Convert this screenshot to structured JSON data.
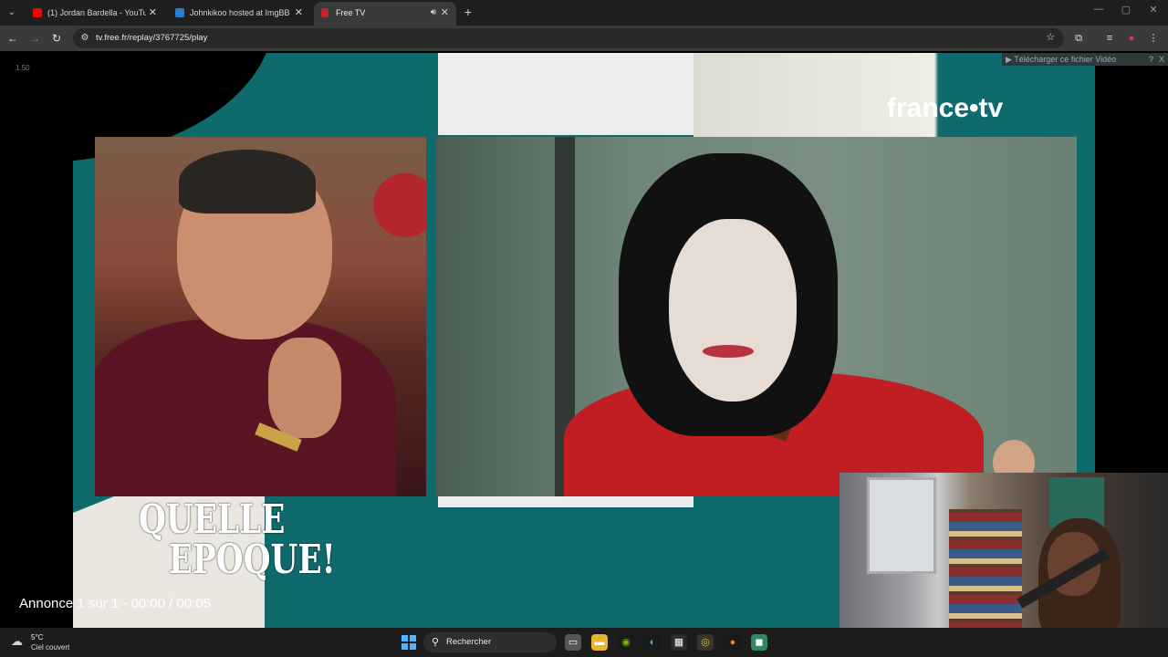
{
  "tabs": [
    {
      "title": "(1) Jordan Bardella - YouTube",
      "icon": "youtube-icon",
      "color": "#ff0000"
    },
    {
      "title": "Johnkikoo hosted at ImgBB —",
      "icon": "imgbb-icon",
      "color": "#2a7fd4"
    },
    {
      "title": "Free TV",
      "icon": "freetv-icon",
      "color": "#c0272d"
    }
  ],
  "new_tab": "+",
  "address": {
    "url": "tv.free.fr/replay/3767725/play"
  },
  "video": {
    "speed": "1.50",
    "channel_logo": "france•tv",
    "show_logo_line1": "QUELLE",
    "show_logo_line2": "EPOQUE!",
    "ad_counter": "Annonce 1 sur 1 - 00:00 / 00:05",
    "download_label": "▶ Télécharger ce fichier Vidéo",
    "download_help": "?",
    "download_close": "X"
  },
  "taskbar": {
    "weather_temp": "5°C",
    "weather_desc": "Ciel couvert",
    "search_placeholder": "Rechercher"
  }
}
